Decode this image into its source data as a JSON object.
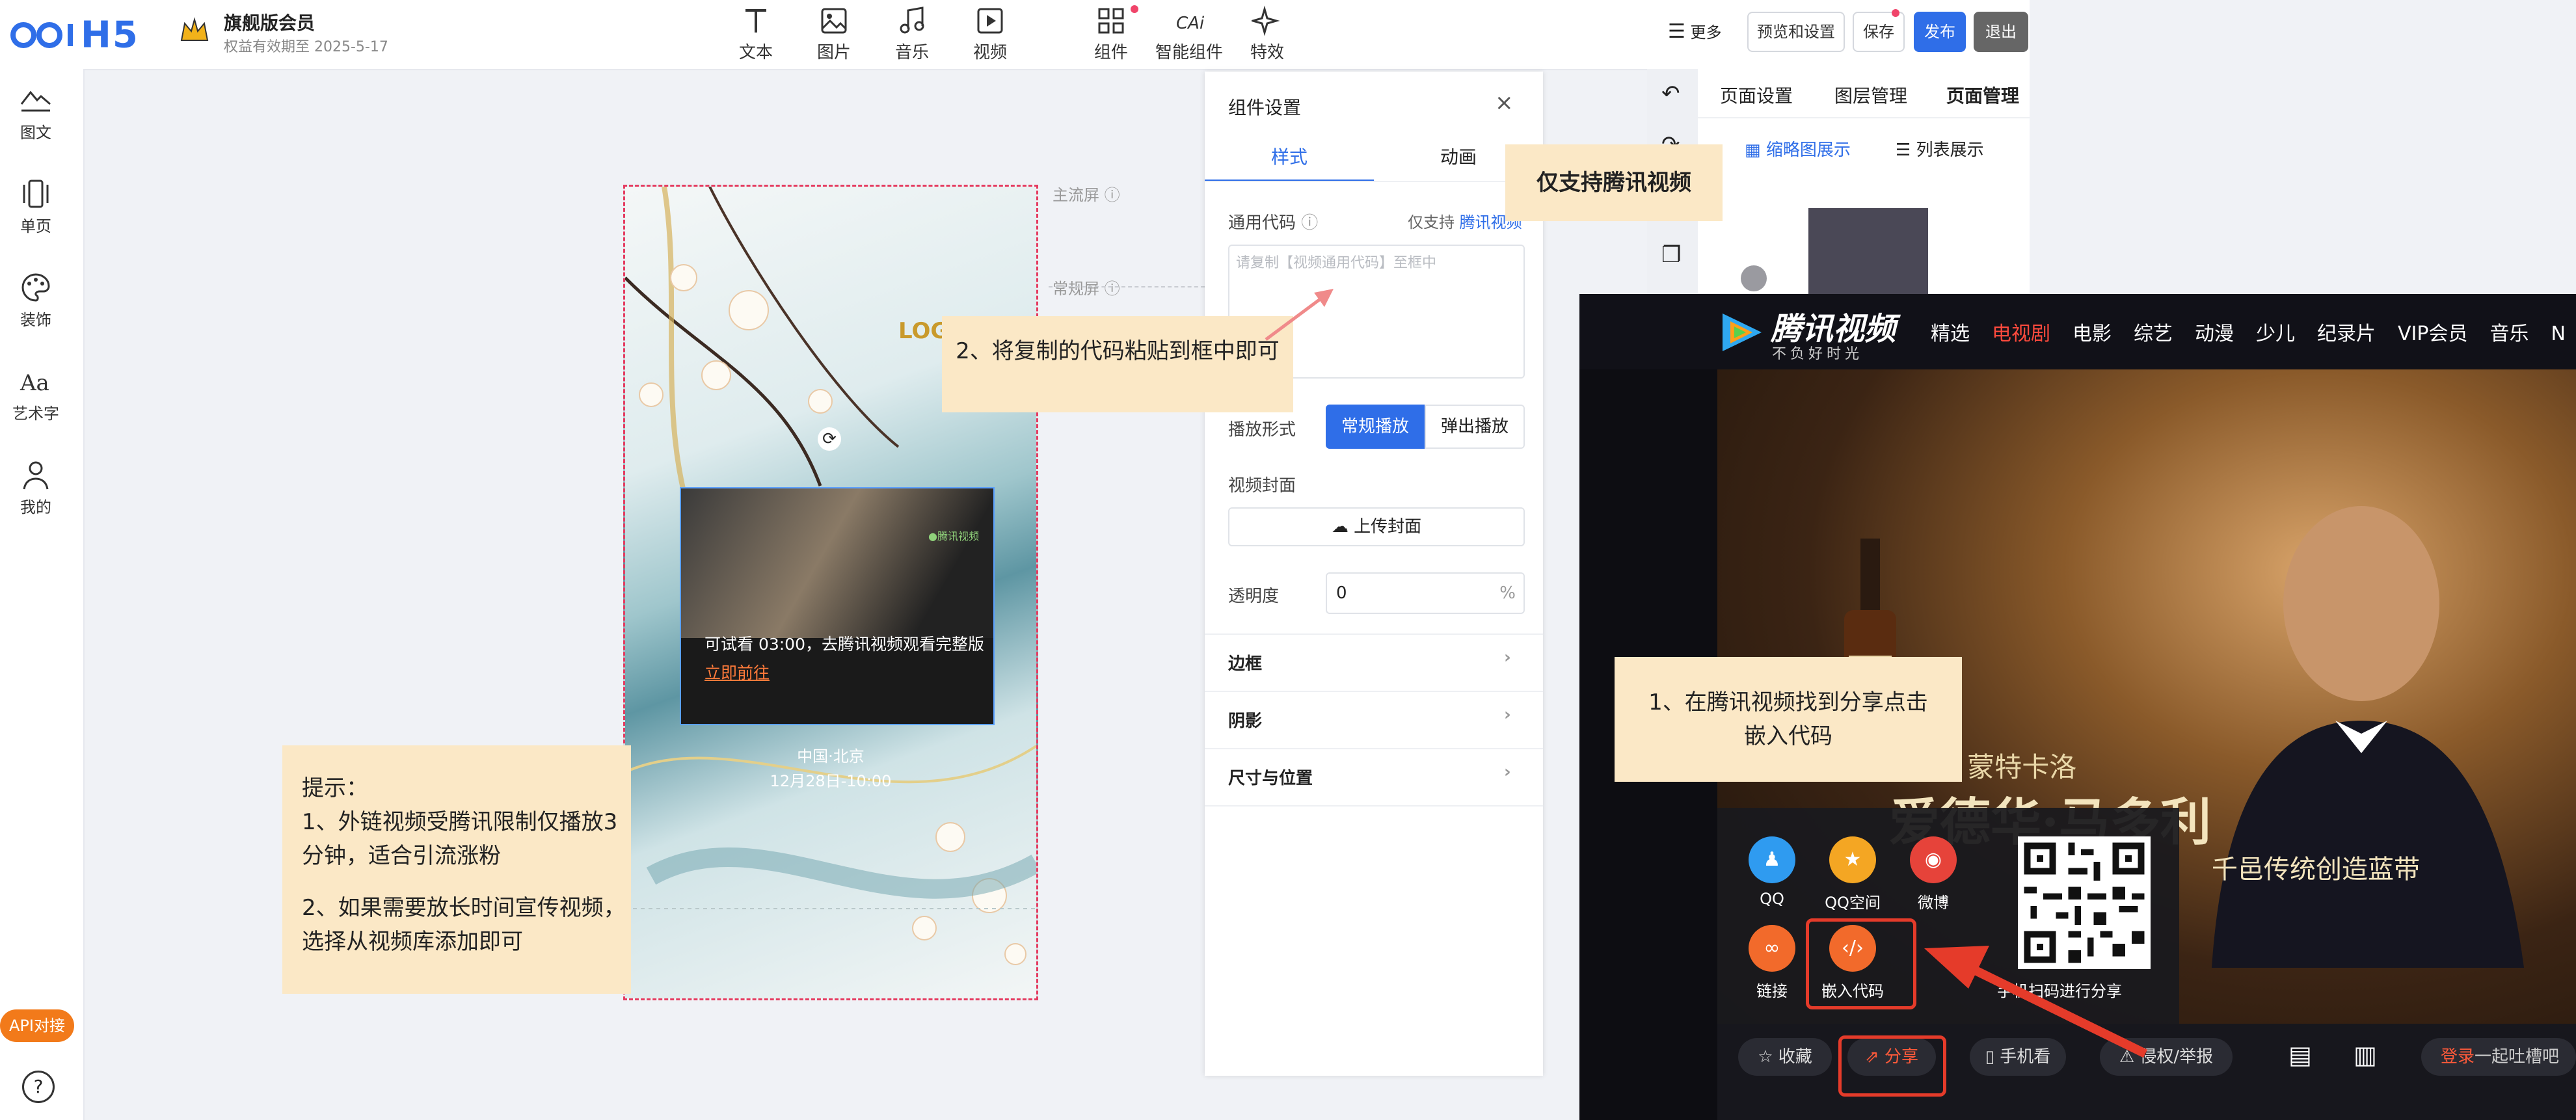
{
  "header": {
    "logo": "H5",
    "membership": "旗舰版会员",
    "expiry": "权益有效期至 2025-5-17",
    "tools": [
      "文本",
      "图片",
      "音乐",
      "视频",
      "组件",
      "智能组件",
      "特效"
    ],
    "more": "更多",
    "preview": "预览和设置",
    "save": "保存",
    "publish": "发布",
    "exit": "退出"
  },
  "left_rail": {
    "items": [
      "图文",
      "单页",
      "装饰",
      "艺术字",
      "我的"
    ],
    "api": "API对接"
  },
  "canvas": {
    "main_screen": "主流屏",
    "normal_screen": "常规屏",
    "logo_text": "LOGO",
    "video_notice": "可试看 03:00，去腾讯视频观看完整版",
    "video_link": "立即前往",
    "location": "中国·北京",
    "date": "12月28日-10:00"
  },
  "tip": {
    "title": "提示：",
    "line1": "1、外链视频受腾讯限制仅播放3分钟，适合引流涨粉",
    "line2": "2、如果需要放长时间宣传视频，选择从视频库添加即可"
  },
  "callouts": {
    "step2": "2、将复制的代码粘贴到框中即可",
    "only_tencent": "仅支持腾讯视频",
    "step1": "1、在腾讯视频找到分享点击嵌入代码"
  },
  "panel": {
    "title": "组件设置",
    "tab_style": "样式",
    "tab_animation": "动画",
    "code_label": "通用代码",
    "only_support": "仅支持",
    "tencent_video_link": "腾讯视频",
    "code_placeholder": "请复制【视频通用代码】至框中",
    "play_mode_label": "播放形式",
    "play_normal": "常规播放",
    "play_popup": "弹出播放",
    "cover_label": "视频封面",
    "upload_cover": "上传封面",
    "opacity_label": "透明度",
    "opacity_value": "0",
    "opacity_unit": "%",
    "border": "边框",
    "shadow": "阴影",
    "size_position": "尺寸与位置"
  },
  "right_panel": {
    "tabs": [
      "页面设置",
      "图层管理",
      "页面管理"
    ],
    "thumb_view": "缩略图展示",
    "list_view": "列表展示"
  },
  "tencent": {
    "brand": "腾讯视频",
    "slogan": "不负好时光",
    "nav": [
      "精选",
      "电视剧",
      "电影",
      "综艺",
      "动漫",
      "少儿",
      "纪录片",
      "VIP会员",
      "音乐",
      "N"
    ],
    "poster_small": "1912 蒙特卡洛",
    "poster_big": "爱德华·马多利",
    "poster_sub": "千邑传统创造蓝带",
    "share": [
      {
        "label": "QQ",
        "color": "#2f9bf0"
      },
      {
        "label": "QQ空间",
        "color": "#f4a623"
      },
      {
        "label": "微博",
        "color": "#e6433a"
      },
      {
        "label": "链接",
        "color": "#f26a2b"
      },
      {
        "label": "嵌入代码",
        "color": "#f26a2b"
      }
    ],
    "qr_hint": "手机扫码进行分享",
    "bottom": [
      "收藏",
      "分享",
      "手机看",
      "侵权/举报"
    ],
    "login": "登录",
    "login_tail": "一起吐槽吧"
  }
}
